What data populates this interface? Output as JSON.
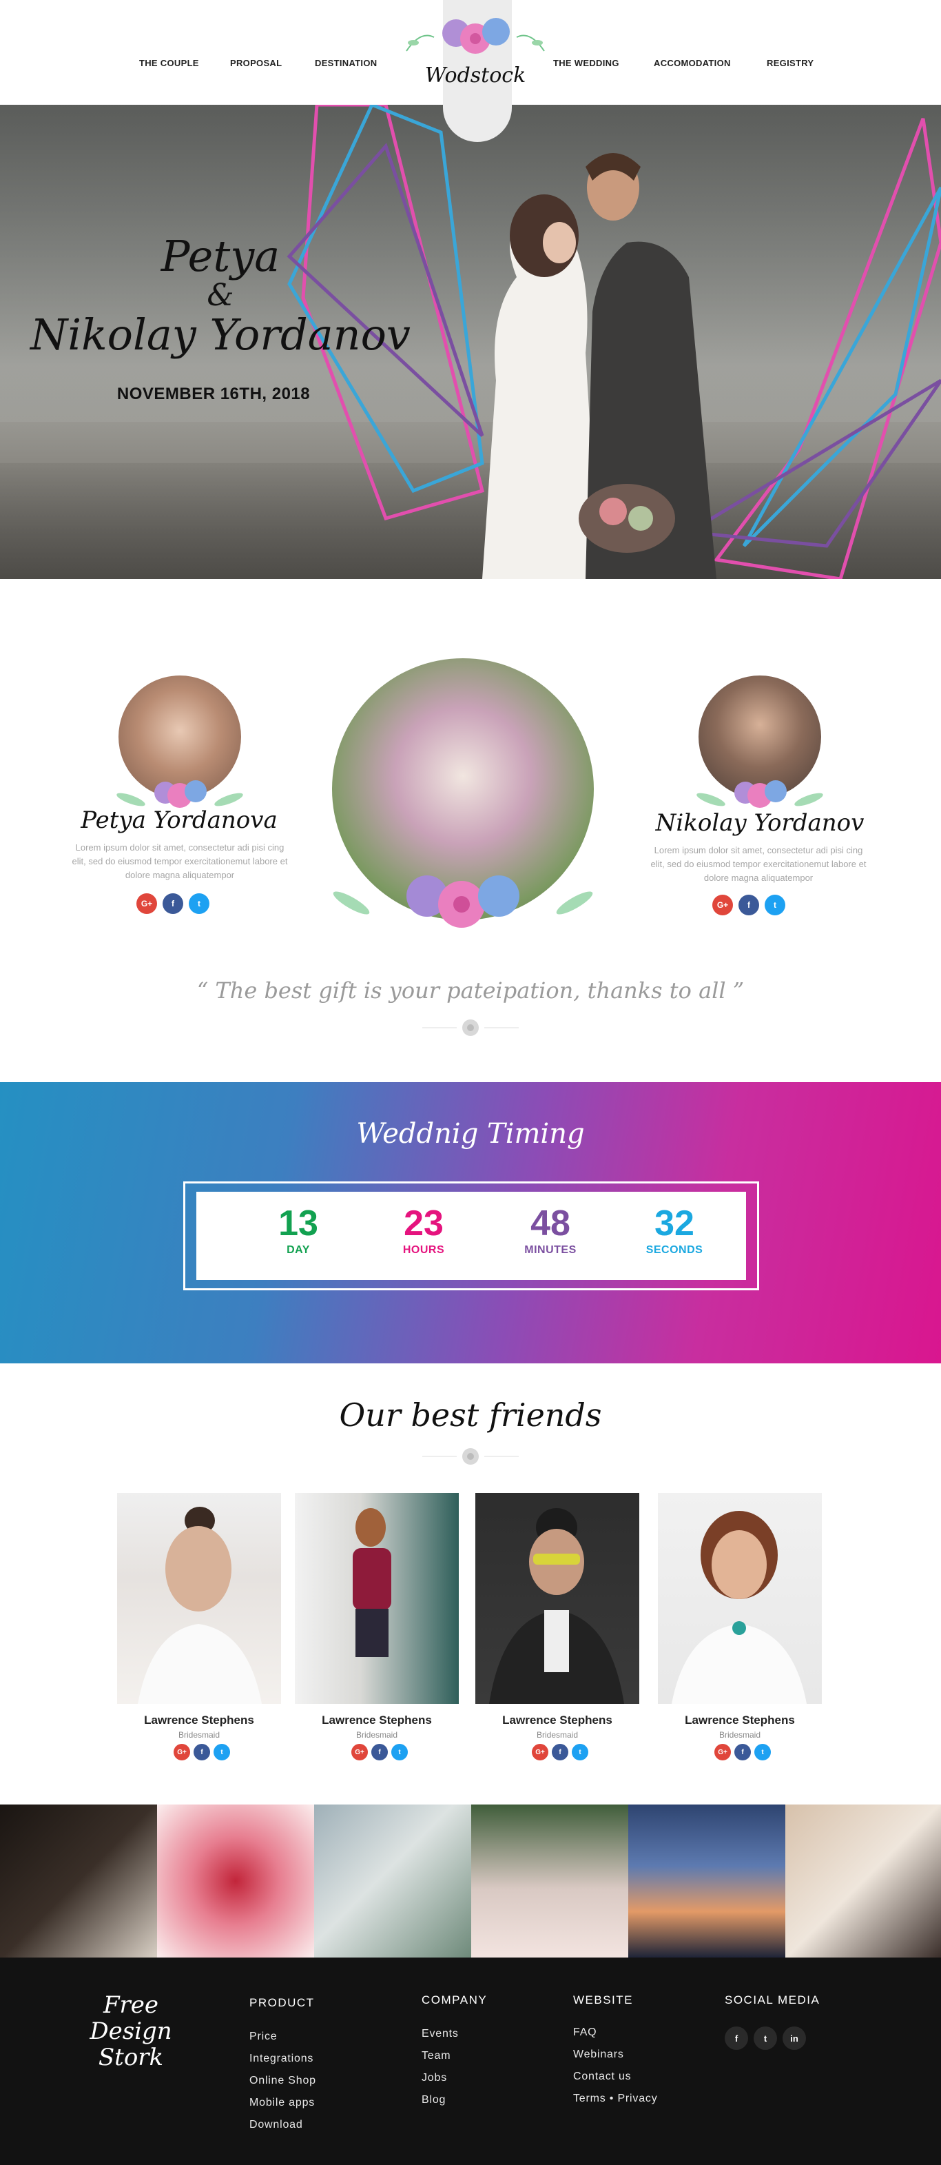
{
  "header": {
    "logo": "Wodstock",
    "nav_left": [
      "THE COUPLE",
      "PROPOSAL",
      "DESTINATION"
    ],
    "nav_right": [
      "THE WEDDING",
      "ACCOMODATION",
      "REGISTRY"
    ]
  },
  "hero": {
    "name_one": "Petya",
    "ampersand": "&",
    "name_two": "Nikolay Yordanov",
    "date": "NOVEMBER 16TH, 2018"
  },
  "couple": {
    "bride": {
      "name": "Petya Yordanova",
      "bio": "Lorem ipsum dolor sit amet, consectetur adi pisi cing elit, sed do eiusmod tempor exercitationemut labore et dolore magna aliquatempor"
    },
    "groom": {
      "name": "Nikolay Yordanov",
      "bio": "Lorem ipsum dolor sit amet, consectetur adi pisi cing elit, sed do eiusmod tempor exercitationemut labore et dolore magna aliquatempor"
    },
    "quote": "“ The best gift is your pateipation, thanks to all ”"
  },
  "countdown": {
    "title": "Weddnig Timing",
    "units": [
      {
        "value": "13",
        "label": "DAY",
        "color": "#12a150"
      },
      {
        "value": "23",
        "label": "HOURS",
        "color": "#e5137e"
      },
      {
        "value": "48",
        "label": "MINUTES",
        "color": "#7b4fa0"
      },
      {
        "value": "32",
        "label": "SECONDS",
        "color": "#1ba8e0"
      }
    ]
  },
  "friends": {
    "title": "Our best friends",
    "items": [
      {
        "name": "Lawrence Stephens",
        "role": "Bridesmaid"
      },
      {
        "name": "Lawrence Stephens",
        "role": "Bridesmaid"
      },
      {
        "name": "Lawrence Stephens",
        "role": "Bridesmaid"
      },
      {
        "name": "Lawrence Stephens",
        "role": "Bridesmaid"
      }
    ]
  },
  "footer": {
    "logo_line1": "Free Design",
    "logo_line2": "Stork",
    "product": {
      "title": "PRODUCT",
      "links": [
        "Price",
        "Integrations",
        "Online Shop",
        "Mobile apps",
        "Download"
      ]
    },
    "company": {
      "title": "COMPANY",
      "links": [
        "Events",
        "Team",
        "Jobs",
        "Blog"
      ]
    },
    "website": {
      "title": "WEBSITE",
      "links": [
        "FAQ",
        "Webinars",
        "Contact us",
        "Terms • Privacy"
      ]
    },
    "social": {
      "title": "SOCIAL MEDIA"
    }
  },
  "icons": {
    "google": "G+",
    "facebook": "f",
    "twitter": "t",
    "linkedin": "in"
  },
  "colors": {
    "pink": "#e5137e",
    "purple": "#7b4fa0",
    "blue": "#1ba8e0",
    "green": "#12a150",
    "footer_bg": "#121212"
  }
}
